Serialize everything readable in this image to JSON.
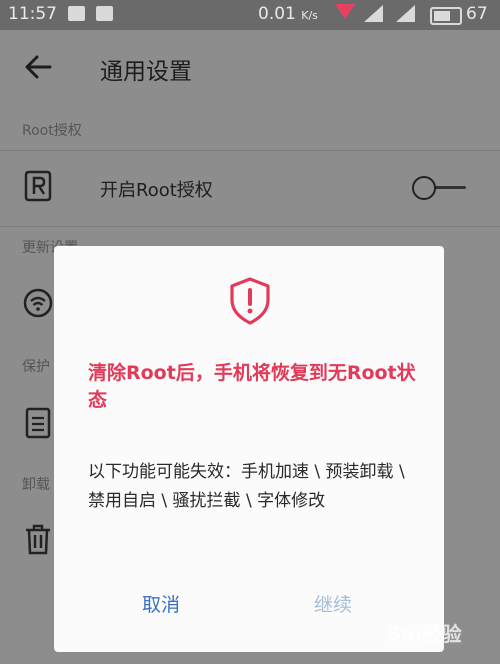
{
  "status_bar": {
    "time": "11:57",
    "speed": "0.01",
    "speed_unit": "K/s",
    "battery": "67"
  },
  "header": {
    "title": "通用设置"
  },
  "sections": {
    "root": "Root授权",
    "update": "更新设置",
    "protect": "保护",
    "uninstall": "卸载"
  },
  "rows": {
    "root_label": "开启Root授权"
  },
  "toggle": {
    "checked": false
  },
  "dialog": {
    "title": "清除Root后，手机将恢复到无Root状态",
    "body": "以下功能可能失效：手机加速 \\ 预装卸载 \\ 禁用自启 \\ 骚扰拦截 \\ 字体修改",
    "cancel_label": "取消",
    "continue_label": "继续"
  },
  "watermark": "Bai经验",
  "colors": {
    "accent_red": "#e23b5a",
    "button_blue": "#3d6fc4",
    "button_disabled": "#a8bdd8"
  }
}
